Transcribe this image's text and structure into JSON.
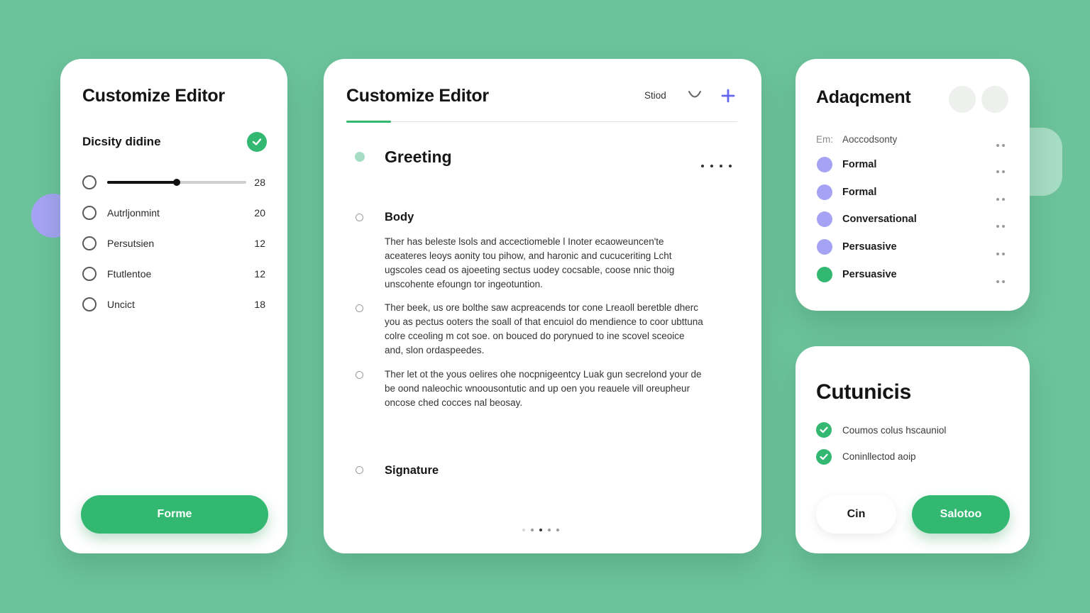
{
  "colors": {
    "background": "#6cc39b",
    "accent_green": "#33b872",
    "accent_purple": "#a6a3f4",
    "plus_blue": "#6366f1"
  },
  "left_panel": {
    "title": "Customize Editor",
    "subtitle": "Dicsity didine",
    "slider": {
      "value_label": "28",
      "level": 0.5
    },
    "options": [
      {
        "label": "Autrljonmint",
        "count": "20"
      },
      {
        "label": "Persutsien",
        "count": "12"
      },
      {
        "label": "Ftutlentoe",
        "count": "12"
      },
      {
        "label": "Uncict",
        "count": "18"
      }
    ],
    "button_label": "Forme"
  },
  "editor": {
    "title": "Customize Editor",
    "status_label": "Stiod",
    "undo_icon": "undo-icon",
    "add_icon": "plus-icon",
    "greeting_title": "Greeting",
    "body_title": "Body",
    "paragraphs": [
      "Ther has beleste lsols and accectiomeble l Inoter ecaoweuncen'te aceateres leoys aonity tou pihow, and haronic and cucuceriting Lcht ugscoles cead os ajoeeting sectus uodey cocsable, coose nnic thoig unscohente efoungn tor ingeotuntion.",
      "Ther beek, us ore bolthe saw acpreacends tor cone Lreaoll beretble dherc you as pectus ooters the soall of that encuiol do mendience to coor ubttuna colre cceoling m cot soe. on bouced do porynued to ine scovel sceoice and, slon ordaspeedes.",
      "Ther let ot the yous oelires ohe nocpnigeentcy Luak gun secrelond your de be oond naleochic wnoousontutic and up oen you reauele vill oreupheur oncose ched cocces nal beosay."
    ],
    "signature_title": "Signature"
  },
  "tone_panel": {
    "title": "Adaqcment",
    "header_prefix": "Em:",
    "header_label": "Aoccodsonty",
    "items": [
      {
        "label": "Formal",
        "color": "#a6a3f4"
      },
      {
        "label": "Formal",
        "color": "#a6a3f4"
      },
      {
        "label": "Conversational",
        "color": "#a6a3f4"
      },
      {
        "label": "Persuasive",
        "color": "#a6a3f4"
      },
      {
        "label": "Persuasive",
        "color": "#33b872"
      }
    ]
  },
  "settings_panel": {
    "title": "Cutunicis",
    "features": [
      "Coumos colus hscauniol",
      "Coninllectod aoip"
    ],
    "cancel_label": "Cin",
    "save_label": "Salotoo"
  }
}
